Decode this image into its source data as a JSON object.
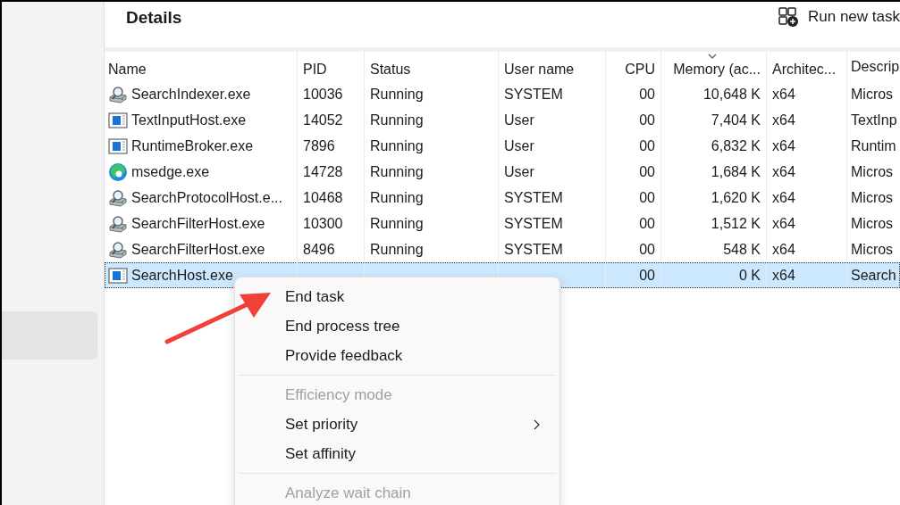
{
  "header": {
    "title": "Details",
    "action": "Run new task"
  },
  "sidebar": {
    "items": [
      {
        "selected": true
      }
    ]
  },
  "table": {
    "columns": [
      {
        "label": "Name",
        "sorted": false
      },
      {
        "label": "PID",
        "sorted": false
      },
      {
        "label": "Status",
        "sorted": false
      },
      {
        "label": "User name",
        "sorted": false
      },
      {
        "label": "CPU",
        "sorted": false
      },
      {
        "label": "Memory (ac...",
        "sorted": true
      },
      {
        "label": "Architec...",
        "sorted": false
      },
      {
        "label": "Descrip",
        "sorted": false
      }
    ],
    "rows": [
      {
        "kind": "service",
        "selected": false,
        "cells": [
          "SearchIndexer.exe",
          "10036",
          "Running",
          "SYSTEM",
          "00",
          "10,648 K",
          "x64",
          "Micros"
        ]
      },
      {
        "kind": "window",
        "selected": false,
        "cells": [
          "TextInputHost.exe",
          "14052",
          "Running",
          "User",
          "00",
          "7,404 K",
          "x64",
          "TextInp"
        ]
      },
      {
        "kind": "window",
        "selected": false,
        "cells": [
          "RuntimeBroker.exe",
          "7896",
          "Running",
          "User",
          "00",
          "6,832 K",
          "x64",
          "Runtim"
        ]
      },
      {
        "kind": "browser",
        "selected": false,
        "cells": [
          "msedge.exe",
          "14728",
          "Running",
          "User",
          "00",
          "1,684 K",
          "x64",
          "Micros"
        ]
      },
      {
        "kind": "service",
        "selected": false,
        "cells": [
          "SearchProtocolHost.e...",
          "10468",
          "Running",
          "SYSTEM",
          "00",
          "1,620 K",
          "x64",
          "Micros"
        ]
      },
      {
        "kind": "service",
        "selected": false,
        "cells": [
          "SearchFilterHost.exe",
          "10300",
          "Running",
          "SYSTEM",
          "00",
          "1,512 K",
          "x64",
          "Micros"
        ]
      },
      {
        "kind": "service",
        "selected": false,
        "cells": [
          "SearchFilterHost.exe",
          "8496",
          "Running",
          "SYSTEM",
          "00",
          "548 K",
          "x64",
          "Micros"
        ]
      },
      {
        "kind": "window",
        "selected": true,
        "cells": [
          "SearchHost.exe",
          null,
          null,
          null,
          "00",
          "0 K",
          "x64",
          "Search"
        ]
      }
    ]
  },
  "context_menu": {
    "items": [
      {
        "kind": "item",
        "label": "End task",
        "disabled": false,
        "submenu": false
      },
      {
        "kind": "item",
        "label": "End process tree",
        "disabled": false,
        "submenu": false
      },
      {
        "kind": "item",
        "label": "Provide feedback",
        "disabled": false,
        "submenu": false
      },
      {
        "kind": "separator"
      },
      {
        "kind": "item",
        "label": "Efficiency mode",
        "disabled": true,
        "submenu": false
      },
      {
        "kind": "item",
        "label": "Set priority",
        "disabled": false,
        "submenu": true
      },
      {
        "kind": "item",
        "label": "Set affinity",
        "disabled": false,
        "submenu": false
      },
      {
        "kind": "separator"
      },
      {
        "kind": "item",
        "label": "Analyze wait chain",
        "disabled": true,
        "submenu": false
      }
    ]
  }
}
